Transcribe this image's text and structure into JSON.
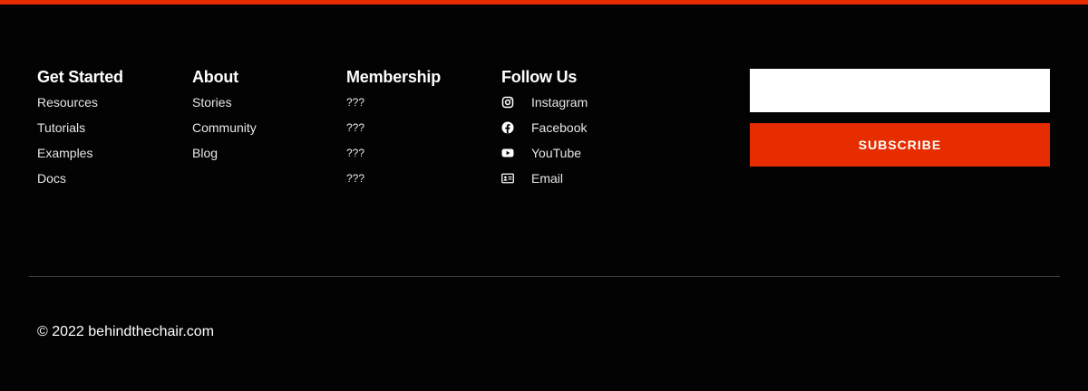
{
  "theme": {
    "accent": "#e72c00",
    "background": "#030303",
    "text": "#ffffff"
  },
  "columns": {
    "get_started": {
      "title": "Get Started",
      "links": [
        "Resources",
        "Tutorials",
        "Examples",
        "Docs"
      ]
    },
    "about": {
      "title": "About",
      "links": [
        "Stories",
        "Community",
        "Blog"
      ]
    },
    "membership": {
      "title": "Membership",
      "links": [
        "???",
        "???",
        "???",
        "???"
      ]
    },
    "follow_us": {
      "title": "Follow Us",
      "links": [
        {
          "label": "Instagram",
          "icon": "instagram-icon"
        },
        {
          "label": "Facebook",
          "icon": "facebook-icon"
        },
        {
          "label": "YouTube",
          "icon": "youtube-icon"
        },
        {
          "label": "Email",
          "icon": "email-card-icon"
        }
      ]
    }
  },
  "newsletter": {
    "input_value": "",
    "button_label": "SUBSCRIBE"
  },
  "footer": {
    "copyright": "© 2022 behindthechair.com"
  }
}
